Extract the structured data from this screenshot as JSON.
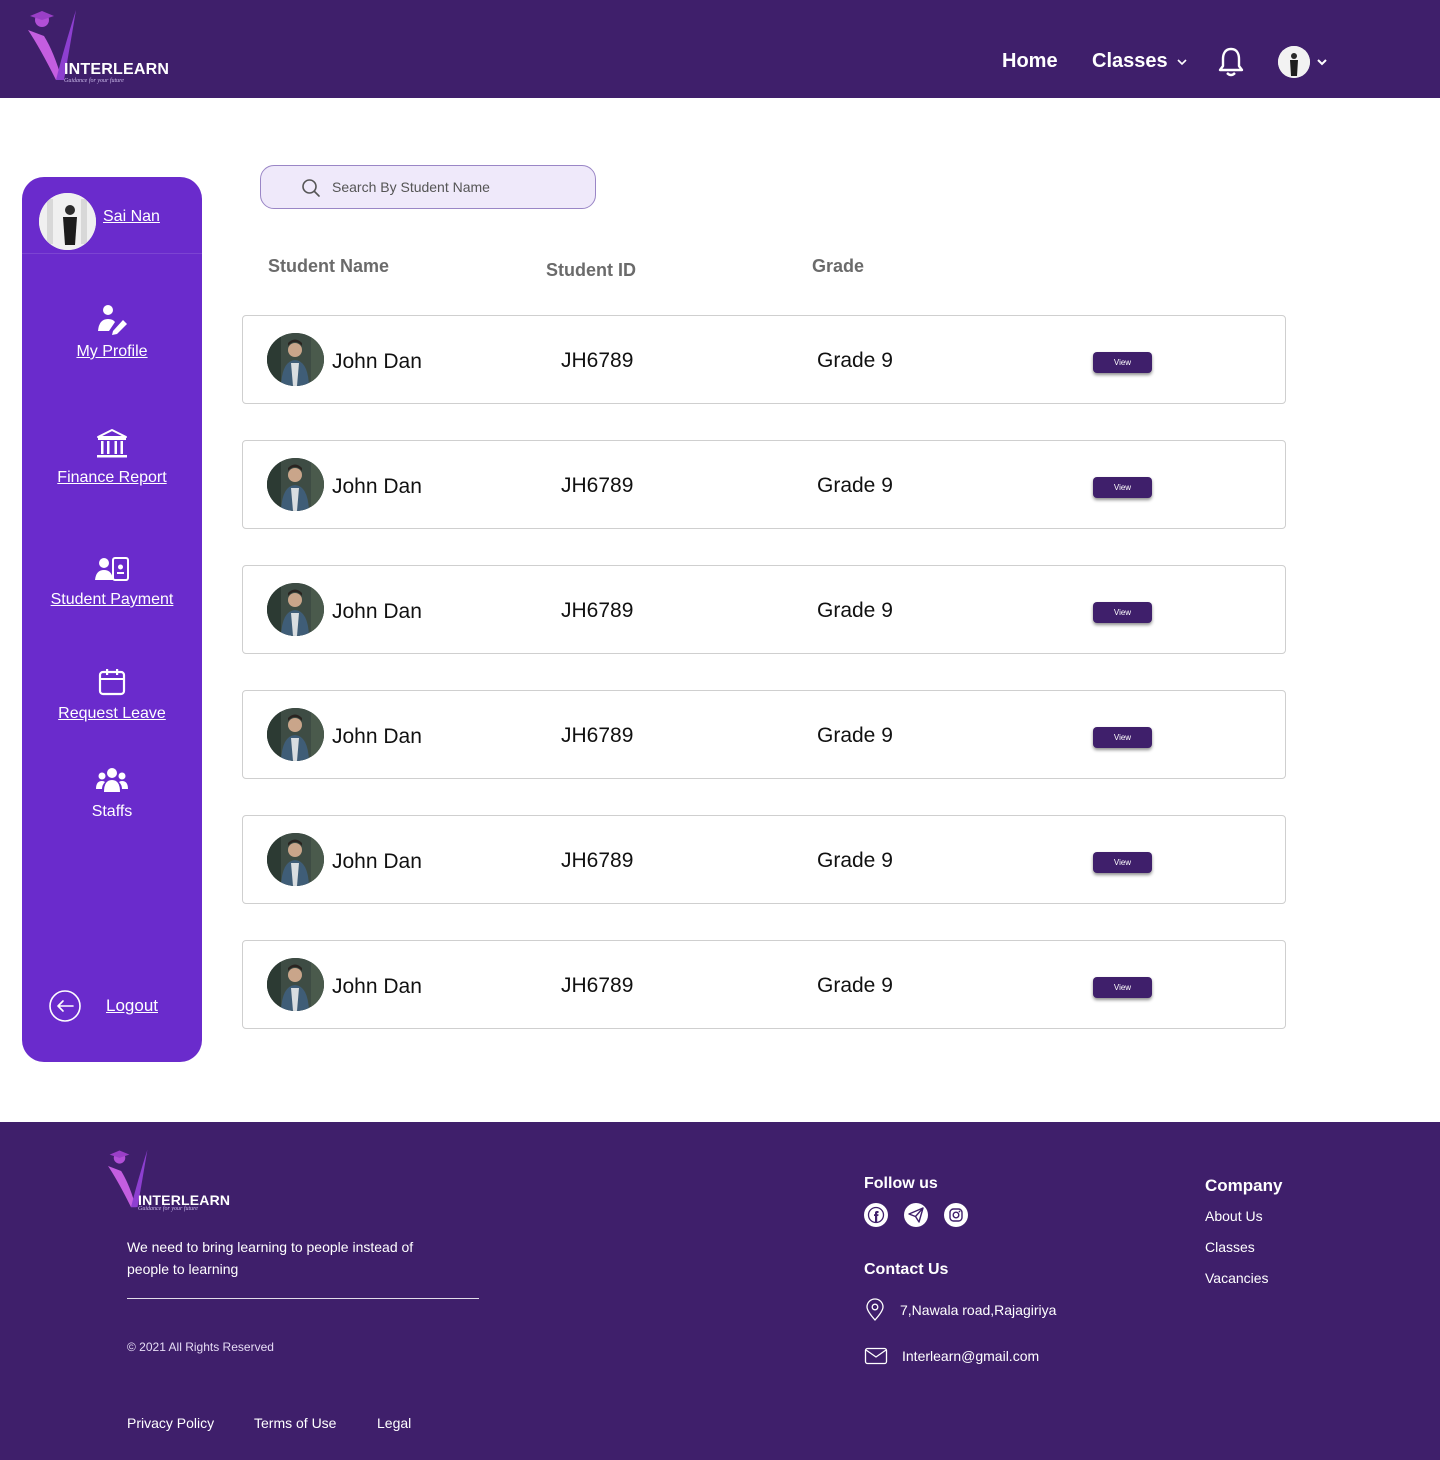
{
  "header": {
    "brand": "INTERLEARN",
    "tagline": "Guidance for your future",
    "nav_home": "Home",
    "nav_classes": "Classes"
  },
  "sidebar": {
    "username": "Sai Nan",
    "items": [
      {
        "label": "My Profile"
      },
      {
        "label": "Finance Report"
      },
      {
        "label": "Student Payment"
      },
      {
        "label": "Request Leave"
      },
      {
        "label": "Staffs"
      }
    ],
    "logout": "Logout"
  },
  "search": {
    "placeholder": "Search By Student Name"
  },
  "table": {
    "headers": [
      "Student Name",
      "Student ID",
      "Grade"
    ],
    "rows": [
      {
        "name": "John Dan",
        "id": "JH6789",
        "grade": "Grade 9",
        "action": "View"
      },
      {
        "name": "John Dan",
        "id": "JH6789",
        "grade": "Grade 9",
        "action": "View"
      },
      {
        "name": "John Dan",
        "id": "JH6789",
        "grade": "Grade 9",
        "action": "View"
      },
      {
        "name": "John Dan",
        "id": "JH6789",
        "grade": "Grade 9",
        "action": "View"
      },
      {
        "name": "John Dan",
        "id": "JH6789",
        "grade": "Grade 9",
        "action": "View"
      },
      {
        "name": "John Dan",
        "id": "JH6789",
        "grade": "Grade 9",
        "action": "View"
      }
    ]
  },
  "footer": {
    "brand": "INTERLEARN",
    "tagline": "Guidance for your future",
    "description": "We need to bring learning to people instead of people to learning",
    "copyright": "© 2021 All Rights Reserved",
    "legal_links": [
      "Privacy Policy",
      "Terms of Use",
      "Legal"
    ],
    "follow_title": "Follow us",
    "social_icons": [
      "facebook-icon",
      "telegram-icon",
      "instagram-icon"
    ],
    "contact_title": "Contact Us",
    "address": "7,Nawala road,Rajagiriya",
    "email": "Interlearn@gmail.com",
    "company_title": "Company",
    "company_links": [
      "About Us",
      "Classes",
      "Vacancies"
    ]
  },
  "colors": {
    "header_bg": "#3f1f6b",
    "sidebar_bg": "#6a2bcc",
    "button_bg": "#3f1f6b",
    "search_bg": "#efe9fa"
  }
}
